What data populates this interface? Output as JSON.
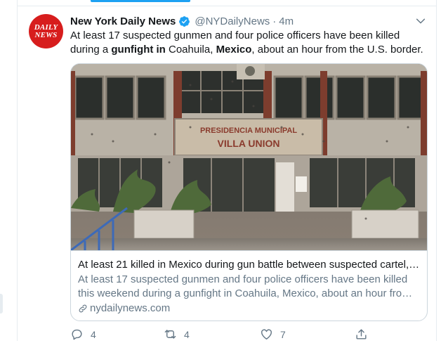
{
  "tweet": {
    "avatar_lines": [
      "DAILY",
      "NEWS"
    ],
    "author_name": "New York Daily News",
    "handle": "@NYDailyNews",
    "separator": "·",
    "time": "4m",
    "text_parts": [
      {
        "t": "At least 17 suspected gunmen and four police officers have been killed during a ",
        "b": false
      },
      {
        "t": "gunfight in",
        "b": true
      },
      {
        "t": " Coahuila, ",
        "b": false
      },
      {
        "t": "Mexico",
        "b": true
      },
      {
        "t": ", about an hour from the U.S. border.",
        "b": false
      }
    ]
  },
  "card": {
    "image_text_line1": "PRESIDENCIA MUNICIPAL",
    "image_text_line2": "VILLA UNION",
    "title": "At least 21 killed in Mexico during gun battle between suspected cartel, ...",
    "description": "At least 17 suspected gunmen and four police officers have been killed this weekend during a gunfight in Coahuila, Mexico, about an hour from ...",
    "domain": "nydailynews.com"
  },
  "actions": {
    "reply_count": "4",
    "retweet_count": "4",
    "like_count": "7"
  },
  "colors": {
    "accent": "#1da1f2",
    "avatar_bg": "#d71d1d",
    "secondary_text": "#657786",
    "border": "#ccd6dd"
  }
}
